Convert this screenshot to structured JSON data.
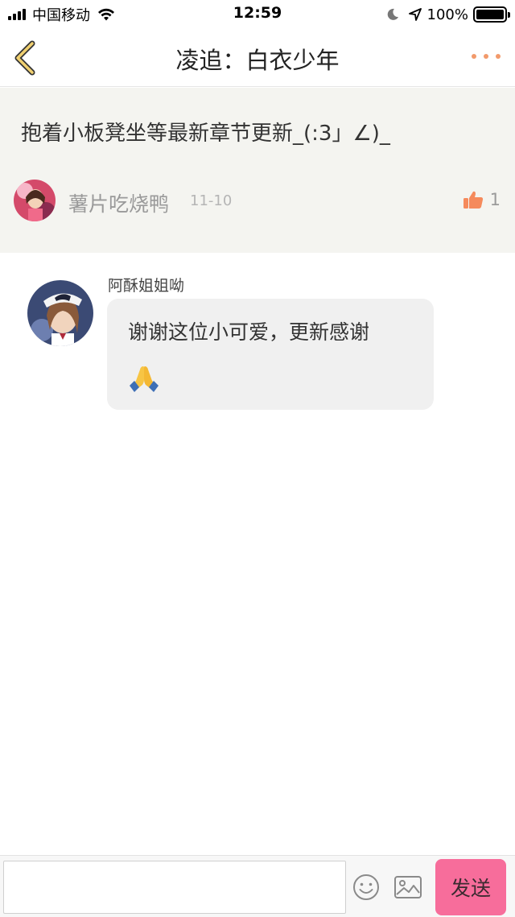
{
  "status_bar": {
    "carrier": "中国移动",
    "time": "12:59",
    "battery_percent": "100%",
    "icons": [
      "signal-icon",
      "wifi-icon",
      "moon-icon",
      "location-arrow-icon",
      "battery-icon"
    ]
  },
  "nav": {
    "title": "凌追：白衣少年",
    "back_icon": "chevron-left-icon",
    "more_icon": "more-dots-icon",
    "accent_color": "#f0a24a"
  },
  "post": {
    "text": "抱着小板凳坐等最新章节更新_(:3」∠)_",
    "author": "薯片吃烧鸭",
    "date": "11-10",
    "like_count": "1",
    "like_icon": "thumbs-up-icon",
    "like_color": "#f58a5c"
  },
  "reply": {
    "author": "阿酥姐姐呦",
    "text": "谢谢这位小可爱，更新感谢",
    "emoji": "folded-hands-icon"
  },
  "composer": {
    "input_value": "",
    "input_placeholder": "",
    "emoji_icon": "smiley-icon",
    "image_icon": "image-icon",
    "send_label": "发送",
    "send_color": "#f76d9b"
  }
}
